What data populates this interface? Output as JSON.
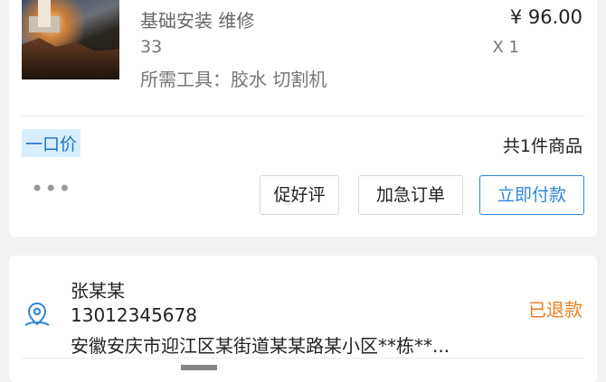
{
  "order": {
    "product_name": "基础安装 维修",
    "product_qty_line": "33",
    "product_tools": "所需工具：胶水 切割机",
    "price": "¥ 96.00",
    "multiplier": "X 1",
    "price_tag": "一口价",
    "item_count": "共1件商品",
    "more_icon": "more-dots-icon",
    "actions": {
      "good_review": "促好评",
      "urgent": "加急订单",
      "pay_now": "立即付款"
    }
  },
  "address": {
    "name": "张某某",
    "phone": "13012345678",
    "address_line": "安徽安庆市迎江区某街道某某路某小区**栋**...",
    "status": "已退款",
    "icon": "location-pin-icon"
  },
  "colors": {
    "accent": "#2f86d8",
    "refund_status": "#f07d1e",
    "tag_bg": "#d9eefc"
  }
}
